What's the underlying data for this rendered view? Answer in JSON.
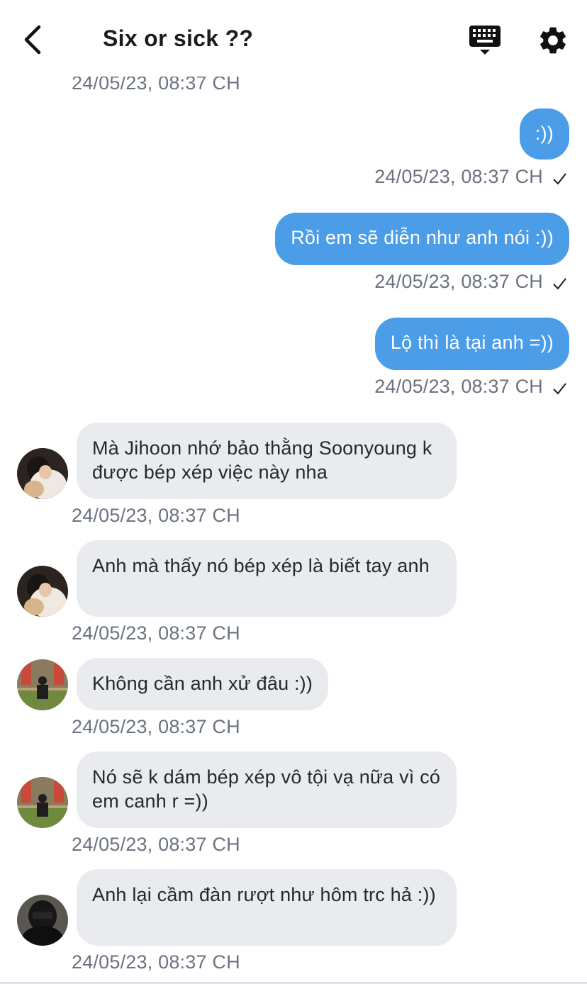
{
  "header": {
    "title": "Six or sick ??",
    "back_icon": "chevron-left-icon",
    "keyboard_icon": "keyboard-icon",
    "settings_icon": "gear-icon"
  },
  "colors": {
    "outgoing_bubble": "#4b9de8",
    "incoming_bubble": "#e9ebee",
    "timestamp": "#6b7280"
  },
  "top_timestamp": "24/05/23, 08:37 CH",
  "messages": [
    {
      "direction": "out",
      "text": ":))",
      "timestamp": "24/05/23, 08:37 CH",
      "status": "sent"
    },
    {
      "direction": "out",
      "text": "Rồi em sẽ diễn như anh nói :))",
      "timestamp": "24/05/23, 08:37 CH",
      "status": "sent"
    },
    {
      "direction": "out",
      "text": "Lộ thì là tại anh =))",
      "timestamp": "24/05/23, 08:37 CH",
      "status": "sent"
    },
    {
      "direction": "in",
      "avatar": "avatar-1",
      "text": "Mà Jihoon nhớ bảo thằng Soonyoung k được bép xép việc này nha",
      "timestamp": "24/05/23, 08:37 CH"
    },
    {
      "direction": "in",
      "avatar": "avatar-1",
      "text": "Anh mà thấy nó bép xép là biết tay anh",
      "timestamp": "24/05/23, 08:37 CH"
    },
    {
      "direction": "in",
      "avatar": "avatar-2",
      "text": "Không cần anh xử đâu :))",
      "timestamp": "24/05/23, 08:37 CH"
    },
    {
      "direction": "in",
      "avatar": "avatar-2",
      "text": "Nó sẽ k dám bép xép vô tội vạ nữa vì có em canh r =))",
      "timestamp": "24/05/23, 08:37 CH"
    },
    {
      "direction": "in",
      "avatar": "avatar-3",
      "text": "Anh lại cầm đàn rượt như hôm trc hả :))",
      "timestamp": "24/05/23, 08:37 CH"
    }
  ]
}
